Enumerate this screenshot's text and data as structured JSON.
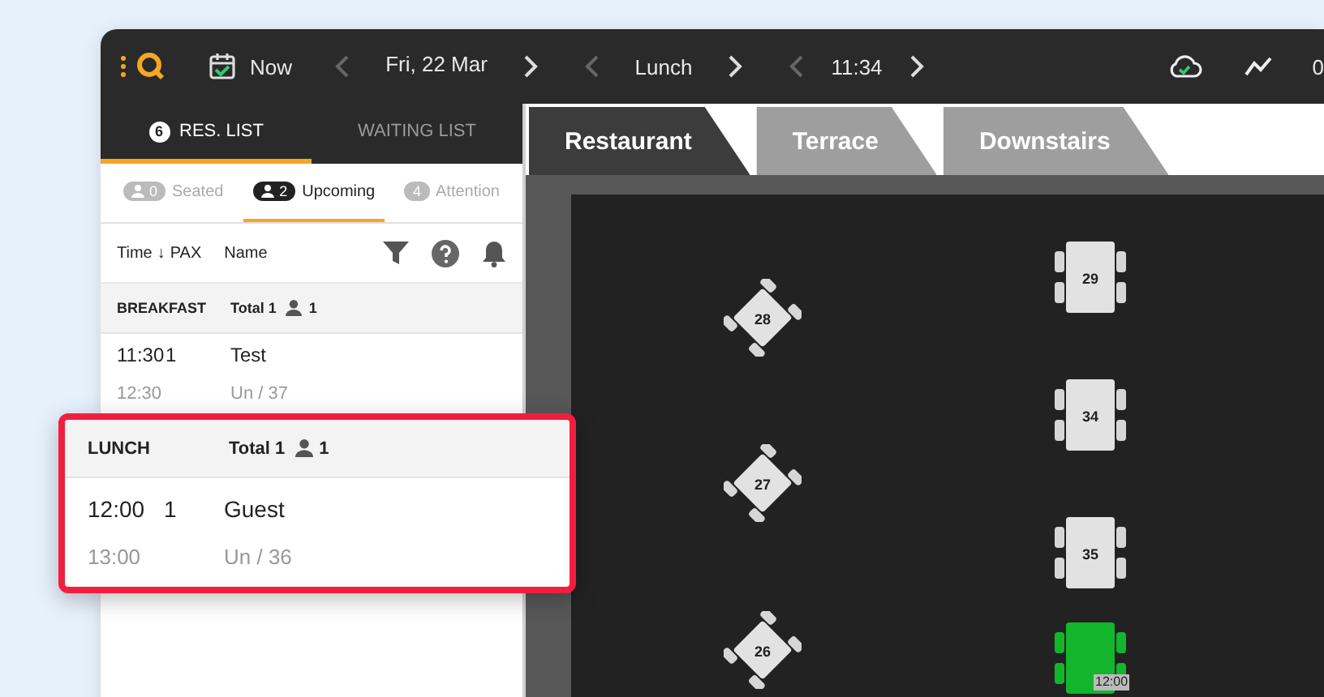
{
  "topbar": {
    "now_label": "Now",
    "date": "Fri, 22 Mar",
    "service": "Lunch",
    "time": "11:34",
    "cut_text": "0"
  },
  "list_tabs": [
    {
      "label": "RES. LIST",
      "count": "6",
      "selected": true
    },
    {
      "label": "WAITING LIST",
      "selected": false
    }
  ],
  "filters": [
    {
      "count": "0",
      "label": "Seated",
      "selected": false,
      "kind": "person"
    },
    {
      "count": "2",
      "label": "Upcoming",
      "selected": true,
      "kind": "person"
    },
    {
      "count": "4",
      "label": "Attention",
      "selected": false,
      "kind": "plain"
    }
  ],
  "columns": {
    "time": "Time",
    "sort_arrow": "↓",
    "pax": "PAX",
    "name": "Name"
  },
  "groups": [
    {
      "name": "BREAKFAST",
      "total": "Total 1",
      "guests": "1",
      "highlighted": false,
      "rows": [
        {
          "time": "11:30",
          "pax": "1",
          "name": "Test",
          "end": "12:30",
          "table": "Un / 37"
        }
      ]
    },
    {
      "name": "LUNCH",
      "total": "Total 1",
      "guests": "1",
      "highlighted": true,
      "rows": [
        {
          "time": "12:00",
          "pax": "1",
          "name": "Guest",
          "end": "13:00",
          "table": "Un / 36"
        }
      ]
    }
  ],
  "areas": [
    {
      "label": "Restaurant",
      "selected": true
    },
    {
      "label": "Terrace",
      "selected": false
    },
    {
      "label": "Downstairs",
      "selected": false
    }
  ],
  "tables": [
    {
      "number": "28",
      "kind": "diamond",
      "color": "#e2e2e2"
    },
    {
      "number": "27",
      "kind": "diamond",
      "color": "#e2e2e2"
    },
    {
      "number": "26",
      "kind": "diamond",
      "color": "#e2e2e2"
    },
    {
      "number": "29",
      "kind": "rect",
      "color": "#e2e2e2"
    },
    {
      "number": "34",
      "kind": "rect",
      "color": "#e2e2e2"
    },
    {
      "number": "35",
      "kind": "rect",
      "color": "#e2e2e2"
    },
    {
      "kind": "rect",
      "color": "#13b52c",
      "time": "12:00"
    }
  ]
}
